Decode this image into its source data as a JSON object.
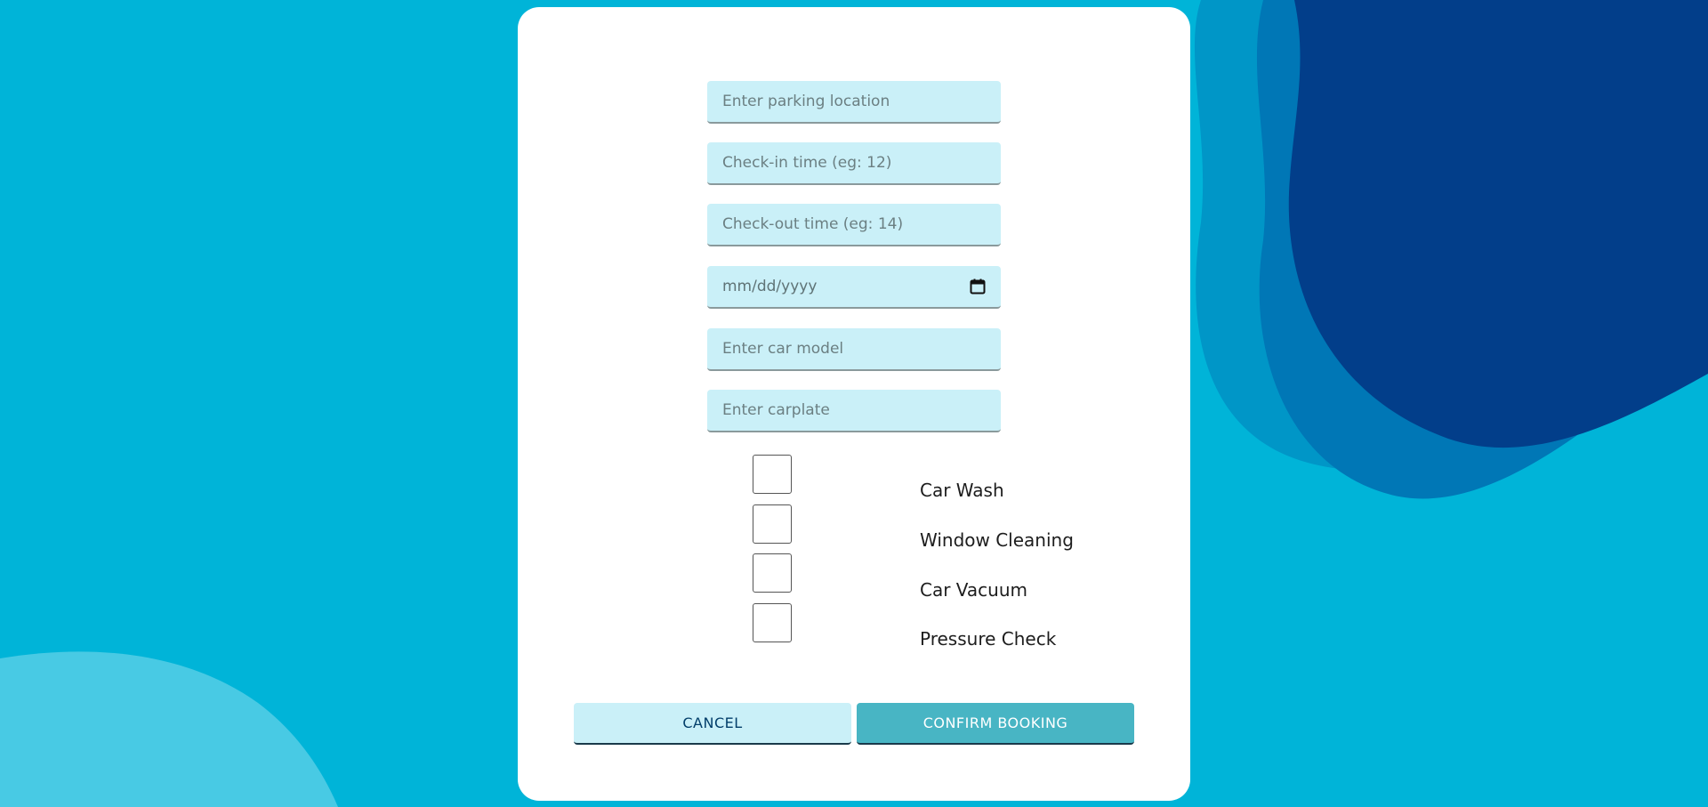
{
  "form": {
    "parking_location": {
      "placeholder": "Enter parking location"
    },
    "check_in": {
      "placeholder": "Check-in time (eg: 12)"
    },
    "check_out": {
      "placeholder": "Check-out time (eg: 14)"
    },
    "date": {
      "display": "mm/dd/yyyy"
    },
    "car_model": {
      "placeholder": "Enter car model"
    },
    "carplate": {
      "placeholder": "Enter carplate"
    }
  },
  "services": [
    {
      "label": "Car Wash",
      "checked": false
    },
    {
      "label": "Window Cleaning",
      "checked": false
    },
    {
      "label": "Car Vacuum",
      "checked": false
    },
    {
      "label": "Pressure Check",
      "checked": false
    }
  ],
  "buttons": {
    "cancel": "CANCEL",
    "confirm": "CONFIRM BOOKING"
  },
  "colors": {
    "background": "#00b4d8",
    "wave_mid": "#0096c7",
    "wave_dark": "#0077b6",
    "wave_darkest": "#023e8a",
    "wave_light": "#48cae4",
    "field_bg": "#caf0f8",
    "confirm_bg": "#48b5c4"
  }
}
